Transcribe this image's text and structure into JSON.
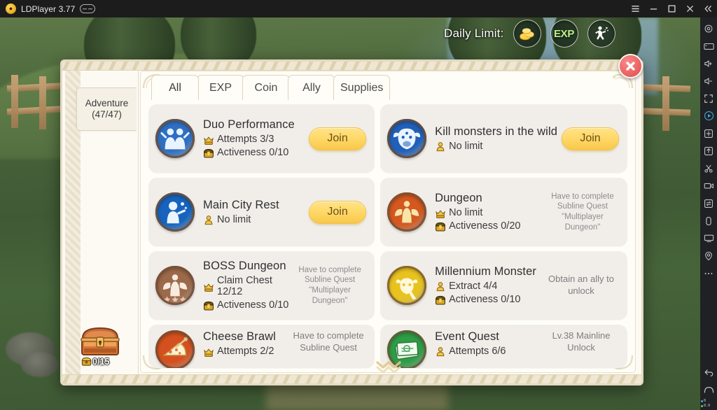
{
  "titlebar": {
    "app_name": "LDPlayer 3.77",
    "logo_icon": "ldplayer-logo-icon",
    "link_badge_icon": "multi-instance-badge-icon",
    "controls": [
      {
        "name": "menu-button",
        "icon": "hamburger-menu-icon"
      },
      {
        "name": "minimize-button",
        "icon": "minimize-icon"
      },
      {
        "name": "maximize-button",
        "icon": "maximize-icon"
      },
      {
        "name": "close-button",
        "icon": "close-icon"
      },
      {
        "name": "collapse-button",
        "icon": "double-chevron-left-icon"
      }
    ]
  },
  "hud": {
    "daily_limit_label": "Daily Limit:",
    "orbs": [
      {
        "name": "coin-limit-orb",
        "icon": "gold-coins-icon",
        "label": ""
      },
      {
        "name": "exp-limit-orb",
        "icon": "exp-icon",
        "label": "EXP"
      },
      {
        "name": "activity-limit-orb",
        "icon": "running-figure-icon",
        "label": ""
      }
    ]
  },
  "panel": {
    "close_button_label": "✕",
    "sidebar": {
      "tab_label_line1": "Adventure",
      "tab_label_line2": "(47/47)",
      "chest_icon": "treasure-chest-icon",
      "chest_count": "0/15",
      "chest_badge_icon": "activeness-chest-icon"
    },
    "tabs": [
      {
        "label": "All",
        "active": true
      },
      {
        "label": "EXP",
        "active": false
      },
      {
        "label": "Coin",
        "active": false
      },
      {
        "label": "Ally",
        "active": false
      },
      {
        "label": "Supplies",
        "active": false
      }
    ],
    "scroll_down_icon": "chevron-down-scroll-icon",
    "quests": [
      {
        "title": "Duo Performance",
        "icon": "duo-performance-icon",
        "icon_color": "#2e6fc4",
        "ring_color": "#5a4434",
        "stats": [
          {
            "icon": "crown-chest-icon",
            "text": "Attempts 3/3"
          },
          {
            "icon": "activeness-icon",
            "text": "Activeness 0/10"
          }
        ],
        "action": "join",
        "action_label": "Join",
        "lock_note": ""
      },
      {
        "title": "Kill monsters in the wild",
        "icon": "bull-head-icon",
        "icon_color": "#2060b8",
        "ring_color": "#4a3a2c",
        "stats": [
          {
            "icon": "gold-figure-icon",
            "text": "No limit"
          }
        ],
        "action": "join",
        "action_label": "Join",
        "lock_note": ""
      },
      {
        "title": "Main City Rest",
        "icon": "resting-character-icon",
        "icon_color": "#1763bd",
        "ring_color": "#55412f",
        "stats": [
          {
            "icon": "gold-figure-icon",
            "text": "No limit"
          }
        ],
        "action": "join",
        "action_label": "Join",
        "lock_note": ""
      },
      {
        "title": "Dungeon",
        "icon": "dungeon-statue-icon",
        "icon_color": "#d4581f",
        "ring_color": "#7a4424",
        "stats": [
          {
            "icon": "crown-chest-icon",
            "text": "No limit"
          },
          {
            "icon": "activeness-icon",
            "text": "Activeness 0/20"
          }
        ],
        "action": "locked",
        "action_label": "",
        "lock_note": "Have to complete Subline Quest \"Multiplayer Dungeon\""
      },
      {
        "title": "BOSS Dungeon",
        "icon": "boss-angel-icon",
        "icon_color": "#9c6a4a",
        "ring_color": "#6a4630",
        "stats": [
          {
            "icon": "crown-chest-icon",
            "text": "Claim Chest 12/12"
          },
          {
            "icon": "activeness-icon",
            "text": "Activeness 0/10"
          }
        ],
        "action": "locked",
        "action_label": "",
        "lock_note": "Have to complete Subline Quest \"Multiplayer Dungeon\""
      },
      {
        "title": "Millennium Monster",
        "icon": "millennium-monster-icon",
        "icon_color": "#e8c31e",
        "ring_color": "#8a6a1c",
        "stats": [
          {
            "icon": "gold-figure-icon",
            "text": "Extract 4/4"
          },
          {
            "icon": "activeness-icon",
            "text": "Activeness 0/10"
          }
        ],
        "action": "locked",
        "action_label": "",
        "lock_note": "Obtain an ally to unlock"
      },
      {
        "title": "Cheese Brawl",
        "icon": "cheese-brawl-icon",
        "icon_color": "#d4511f",
        "ring_color": "#7a3a1c",
        "stats": [
          {
            "icon": "crown-chest-icon",
            "text": "Attempts 2/2"
          }
        ],
        "action": "locked",
        "action_label": "",
        "lock_note": "Have to complete Subline Quest"
      },
      {
        "title": "Event Quest",
        "icon": "event-quest-icon",
        "icon_color": "#2f9c46",
        "ring_color": "#4a5c2c",
        "stats": [
          {
            "icon": "gold-figure-icon",
            "text": "Attempts 6/6"
          }
        ],
        "action": "locked",
        "action_label": "",
        "lock_note": "Lv.38 Mainline Unlock"
      }
    ]
  },
  "toolbar": {
    "icons": [
      {
        "name": "settings-gear-icon"
      },
      {
        "name": "keyboard-mapping-icon"
      },
      {
        "name": "volume-up-icon"
      },
      {
        "name": "volume-down-icon"
      },
      {
        "name": "fullscreen-icon"
      },
      {
        "name": "record-play-icon"
      },
      {
        "name": "multi-instance-icon"
      },
      {
        "name": "apk-install-icon"
      },
      {
        "name": "scissors-screenshot-icon"
      },
      {
        "name": "video-record-icon"
      },
      {
        "name": "rotate-screen-icon"
      },
      {
        "name": "shake-icon"
      },
      {
        "name": "virtual-screen-icon"
      },
      {
        "name": "location-pin-icon"
      },
      {
        "name": "more-options-icon"
      },
      {
        "name": "back-nav-icon"
      },
      {
        "name": "home-nav-icon"
      }
    ],
    "stats": {
      "cpu": "0",
      "mem": "0.9"
    },
    "cpu_dot_color": "#4aa3e0",
    "mem_dot_color": "#6fcf5a"
  }
}
